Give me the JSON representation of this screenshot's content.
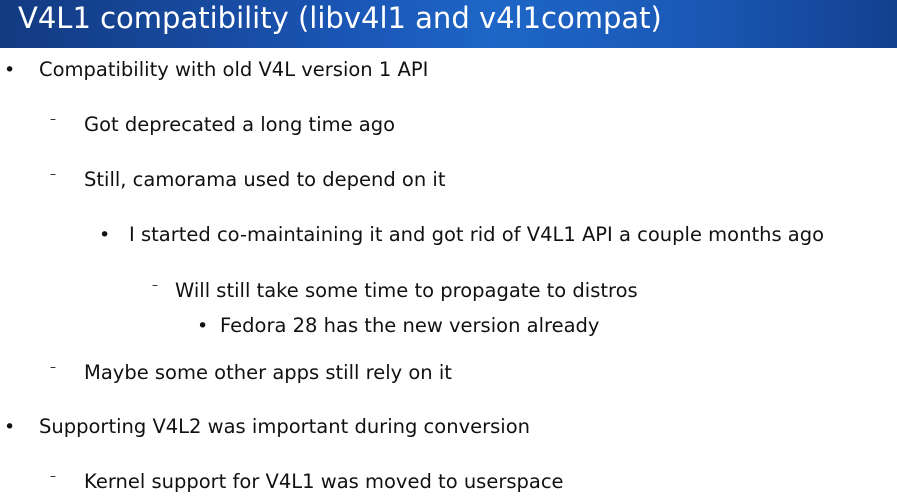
{
  "slide": {
    "title": "V4L1 compatibility (libv4l1 and v4l1compat)",
    "bullets": [
      {
        "marker": "•",
        "text": "Compatibility with old V4L version 1 API"
      },
      {
        "marker": "–",
        "text": "Got deprecated a long time ago"
      },
      {
        "marker": "–",
        "text": "Still, camorama used to depend on it"
      },
      {
        "marker": "•",
        "text": "I started co-maintaining it and got rid of V4L1 API a couple months ago"
      },
      {
        "marker": "–",
        "text": "Will still take some time to propagate to distros"
      },
      {
        "marker": "•",
        "text": "Fedora 28 has the new version already"
      },
      {
        "marker": "–",
        "text": "Maybe some other apps still rely on it"
      },
      {
        "marker": "•",
        "text": "Supporting V4L2 was important during conversion"
      },
      {
        "marker": "–",
        "text": "Kernel support for V4L1 was moved to userspace"
      }
    ]
  }
}
